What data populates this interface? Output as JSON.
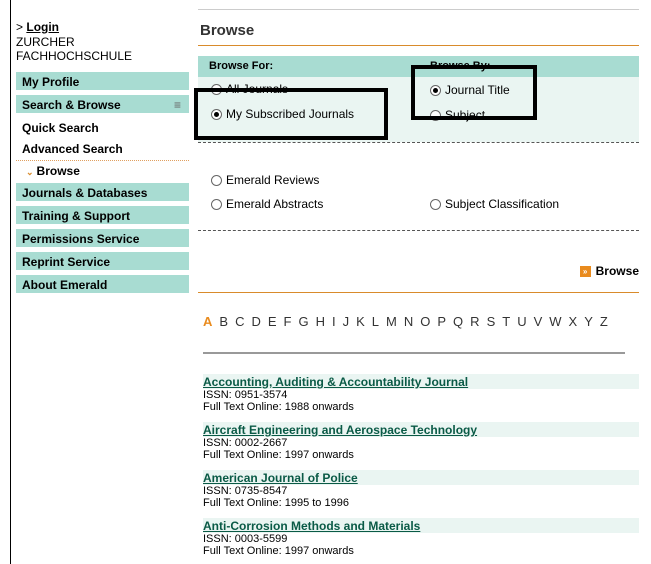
{
  "sidebar": {
    "login_prefix": ">",
    "login_label": "Login",
    "institution": "ZURCHER FACHHOCHSCHULE",
    "items": [
      {
        "label": "My Profile"
      },
      {
        "label": "Search & Browse",
        "expand": "≡"
      },
      {
        "label": "Quick Search"
      },
      {
        "label": "Advanced Search"
      },
      {
        "label": "Browse"
      },
      {
        "label": "Journals & Databases"
      },
      {
        "label": "Training & Support"
      },
      {
        "label": "Permissions Service"
      },
      {
        "label": "Reprint Service"
      },
      {
        "label": "About Emerald"
      }
    ]
  },
  "main": {
    "title": "Browse",
    "browse_for_label": "Browse For:",
    "browse_by_label": "Browse By:",
    "options": {
      "all_journals": "All Journals",
      "my_subscribed": "My Subscribed Journals",
      "journal_title": "Journal Title",
      "subject": "Subject",
      "emerald_reviews": "Emerald Reviews",
      "emerald_abstracts": "Emerald Abstracts",
      "subject_classification": "Subject Classification"
    },
    "browse_button": "Browse",
    "alphabet": [
      "A",
      "B",
      "C",
      "D",
      "E",
      "F",
      "G",
      "H",
      "I",
      "J",
      "K",
      "L",
      "M",
      "N",
      "O",
      "P",
      "Q",
      "R",
      "S",
      "T",
      "U",
      "V",
      "W",
      "X",
      "Y",
      "Z"
    ],
    "active_letter": "A",
    "journals": [
      {
        "name": "Accounting, Auditing & Accountability Journal",
        "issn": "ISSN: 0951-3574",
        "fulltext": "Full Text Online: 1988 onwards"
      },
      {
        "name": "Aircraft Engineering and Aerospace Technology",
        "issn": "ISSN: 0002-2667",
        "fulltext": "Full Text Online: 1997 onwards"
      },
      {
        "name": "American Journal of Police",
        "issn": "ISSN: 0735-8547",
        "fulltext": "Full Text Online: 1995 to 1996"
      },
      {
        "name": "Anti-Corrosion Methods and Materials",
        "issn": "ISSN: 0003-5599",
        "fulltext": "Full Text Online: 1997 onwards"
      }
    ]
  },
  "colors": {
    "nav_green": "#a8dcd2",
    "panel_bg": "#eaf5f2",
    "accent_orange": "#e98b1e",
    "link_green": "#0a5a46"
  }
}
